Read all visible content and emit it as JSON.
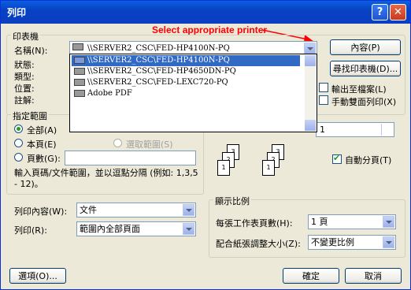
{
  "window": {
    "title": "列印",
    "help_glyph": "?",
    "close_glyph": "✕"
  },
  "annotation": {
    "text": "Select appropriate printer",
    "color": "#ff0000"
  },
  "printer": {
    "group_label": "印表機",
    "name_label": "名稱(N):",
    "status_label": "狀態:",
    "type_label": "類型:",
    "location_label": "位置:",
    "comment_label": "註解:",
    "selected": "\\\\SERVER2_CSC\\FED-HP4100N-PQ",
    "options": [
      "\\\\SERVER2_CSC\\FED-HP4100N-PQ",
      "\\\\SERVER2_CSC\\FED-HP4650DN-PQ",
      "\\\\SERVER2_CSC\\FED-LEXC720-PQ",
      "Adobe PDF"
    ],
    "properties_button": "內容(P)",
    "find_button": "尋找印表機(D)...",
    "print_to_file": "輸出至檔案(L)",
    "manual_duplex": "手動雙面列印(X)"
  },
  "range": {
    "group_label": "指定範圍",
    "all": "全部(A)",
    "current_page": "本頁(E)",
    "selection": "選取範圍(S)",
    "pages": "頁數(G):",
    "pages_value": "",
    "hint": "輸入頁碼/文件範圍，並以逗點分隔 (例如: 1,3,5 - 12)。"
  },
  "copies": {
    "count_value": "1",
    "collate": "自動分頁(T)",
    "page_numbers": [
      "1",
      "2",
      "3"
    ]
  },
  "print_what": {
    "label": "列印內容(W):",
    "value": "文件"
  },
  "print": {
    "label": "列印(R):",
    "value": "範圍內全部頁面"
  },
  "zoom": {
    "group_label": "顯示比例",
    "pages_per_sheet_label": "每張工作表頁數(H):",
    "pages_per_sheet_value": "1 頁",
    "scale_label": "配合紙張調整大小(Z):",
    "scale_value": "不變更比例"
  },
  "buttons": {
    "options": "選項(O)...",
    "ok": "確定",
    "cancel": "取消"
  }
}
